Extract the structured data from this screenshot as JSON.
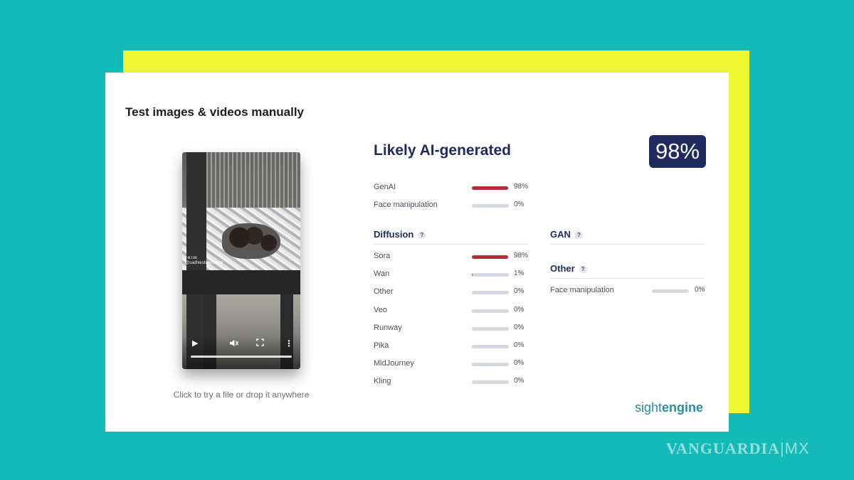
{
  "title": "Test images & videos manually",
  "video": {
    "tiktok_brand": "TikTok",
    "tiktok_handle": "@sadhiestwomidsnl",
    "icons": {
      "play": "play-icon",
      "mute": "volume-muted-icon",
      "fullscreen": "fullscreen-icon",
      "more": "more-vertical-icon"
    },
    "progress": 0.0
  },
  "drop_hint": "Click to try a file or drop it anywhere",
  "verdict": {
    "label": "Likely AI-generated",
    "score": "98%"
  },
  "summary": [
    {
      "label": "GenAI",
      "value": 98,
      "pct": "98%"
    },
    {
      "label": "Face manipulation",
      "value": 0,
      "pct": "0%"
    }
  ],
  "diffusion": {
    "heading": "Diffusion",
    "help": "?",
    "items": [
      {
        "label": "Sora",
        "value": 98,
        "pct": "98%"
      },
      {
        "label": "Wan",
        "value": 1,
        "pct": "1%"
      },
      {
        "label": "Other",
        "value": 0,
        "pct": "0%"
      },
      {
        "label": "Veo",
        "value": 0,
        "pct": "0%"
      },
      {
        "label": "Runway",
        "value": 0,
        "pct": "0%"
      },
      {
        "label": "Pika",
        "value": 0,
        "pct": "0%"
      },
      {
        "label": "MidJourney",
        "value": 0,
        "pct": "0%"
      },
      {
        "label": "Kling",
        "value": 0,
        "pct": "0%"
      }
    ]
  },
  "gan": {
    "heading": "GAN",
    "help": "?"
  },
  "other": {
    "heading": "Other",
    "help": "?",
    "items": [
      {
        "label": "Face manipulation",
        "value": 0,
        "pct": "0%"
      }
    ]
  },
  "brand": {
    "part1": "sight",
    "part2": "engine"
  },
  "watermark": {
    "main": "VANGUARDIA",
    "suffix": "|MX"
  },
  "colors": {
    "accent": "#1f2b5e",
    "bar_fill": "#b72a39",
    "bar_track": "#d5d9e2",
    "background": "#14bab8",
    "backdrop": "#eef531"
  }
}
